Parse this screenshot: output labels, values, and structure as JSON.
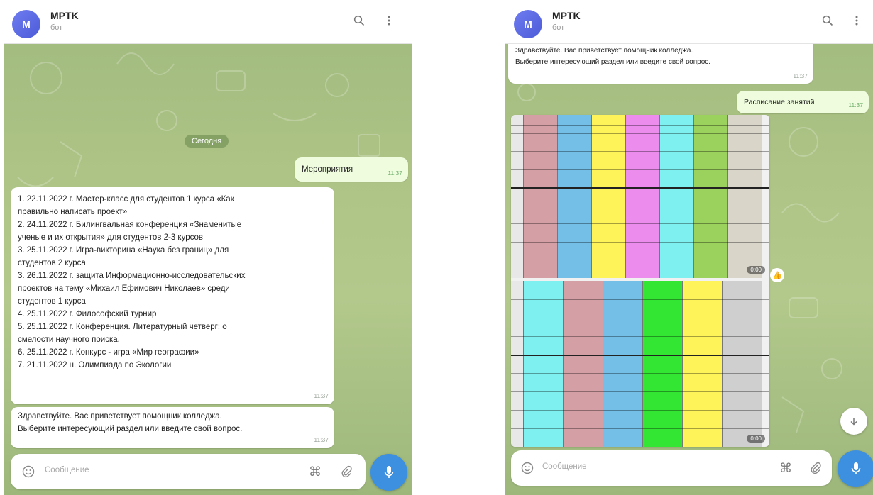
{
  "left": {
    "header": {
      "avatar_letter": "M",
      "title": "MPTK",
      "subtitle": "бот"
    },
    "day_label": "Сегодня",
    "outgoing": {
      "text": "Мероприятия",
      "time": "11:37"
    },
    "events": {
      "lines": [
        "1. 22.11.2022 г.  Мастер-класс для студентов 1 курса «Как",
        "правильно написать проект»",
        "2. 24.11.2022 г. Билингвальная конференция «Знаменитые",
        "ученые и их открытия» для студентов 2-3 курсов",
        "3. 25.11.2022 г.  Игра-викторина «Наука без границ» для",
        "студентов 2 курса",
        "3. 26.11.2022 г.  защита Информационно-исследовательских",
        "проектов на тему  «Михаил Ефимович Николаев» среди",
        "студентов 1 курса",
        "4. 25.11.2022 г.  Философский турнир",
        "5. 25.11.2022 г. Конференция. Литературный четверг: о",
        "смелости научного поиска.",
        "6. 25.11.2022 г. Конкурс - игра «Мир географии»",
        "7. 21.11.2022 н. Олимпиада по Экологии"
      ],
      "time": "11:37"
    },
    "greeting": {
      "lines": [
        "Здравствуйте. Вас приветствует помощник колледжа.",
        "Выберите интересующий раздел или введите свой вопрос."
      ],
      "time": "11:37"
    },
    "input": {
      "placeholder": "Сообщение"
    }
  },
  "right": {
    "header": {
      "avatar_letter": "M",
      "title": "MPTK",
      "subtitle": "бот"
    },
    "greeting": {
      "lines": [
        "Здравствуйте. Вас приветствует помощник колледжа.",
        "Выберите интересующий раздел или введите свой вопрос."
      ],
      "time": "11:37"
    },
    "outgoing": {
      "text": "Расписание занятий",
      "time": "11:37"
    },
    "schedule_images": [
      {
        "colors": [
          "#e8e8e8",
          "#d4a0a6",
          "#73bfe8",
          "#fff35a",
          "#ec8cec",
          "#7ff0f0",
          "#9bd25e",
          "#d9d5c9"
        ],
        "duration": "0:00"
      },
      {
        "colors": [
          "#e8e8e8",
          "#7ff0f0",
          "#d4a0a6",
          "#73bfe8",
          "#33e633",
          "#fff35a",
          "#cfcfcf"
        ],
        "duration": "0:00"
      }
    ],
    "reaction_icon": "thumbs-up",
    "input": {
      "placeholder": "Сообщение"
    }
  },
  "colors": {
    "accent": "#3d8fe0",
    "bubble_in": "#ffffff",
    "bubble_out": "#effdde",
    "wallpaper": "#aec486"
  }
}
